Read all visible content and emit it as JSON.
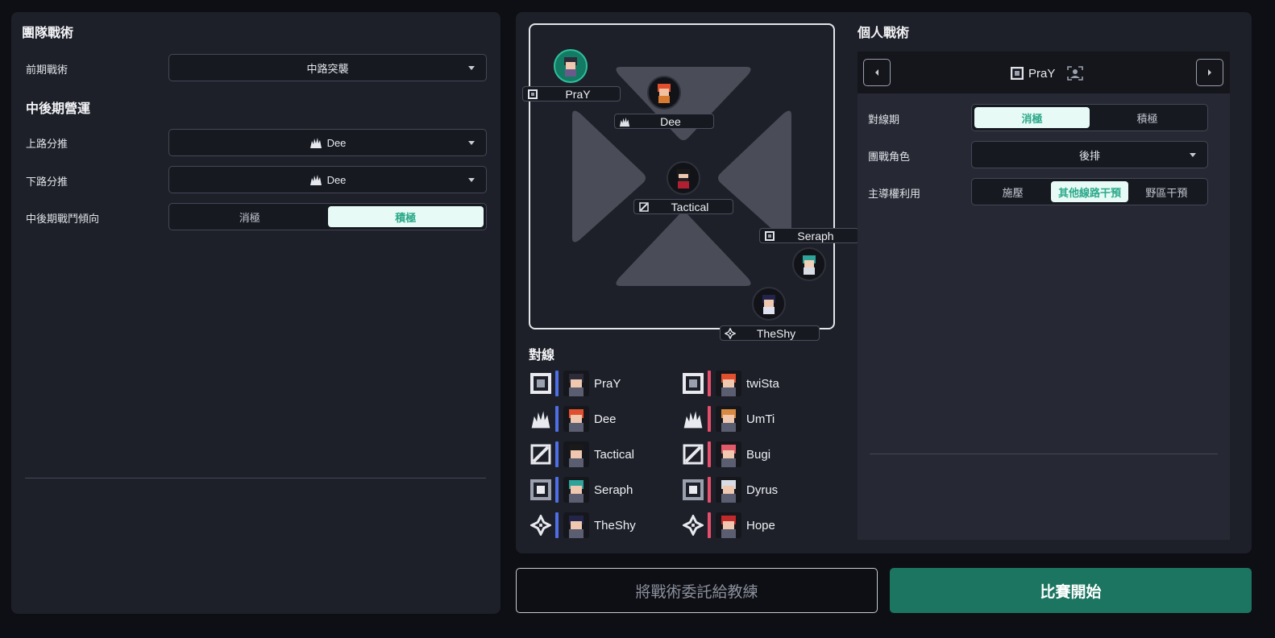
{
  "team_tactics": {
    "title": "團隊戰術",
    "early_label": "前期戰術",
    "early_value": "中路突襲",
    "mid_late_title": "中後期營運",
    "top_push_label": "上路分推",
    "top_push_value": "Dee",
    "bot_push_label": "下路分推",
    "bot_push_value": "Dee",
    "fight_tendency_label": "中後期戰鬥傾向",
    "fight_options": [
      "消極",
      "積極"
    ],
    "fight_selected": "積極"
  },
  "map": {
    "players": [
      {
        "name": "PraY",
        "role_icon": "square-role-icon",
        "selected": true
      },
      {
        "name": "Dee",
        "role_icon": "crown-role-icon"
      },
      {
        "name": "Tactical",
        "role_icon": "slash-role-icon"
      },
      {
        "name": "Seraph",
        "role_icon": "square-role-icon"
      },
      {
        "name": "TheShy",
        "role_icon": "diamond-role-icon"
      }
    ]
  },
  "matchup": {
    "title": "對線",
    "ally": [
      "PraY",
      "Dee",
      "Tactical",
      "Seraph",
      "TheShy"
    ],
    "enemy": [
      "twiSta",
      "UmTi",
      "Bugi",
      "Dyrus",
      "Hope"
    ],
    "colors": {
      "ally": "#4e6fe8",
      "enemy": "#e84e6a"
    }
  },
  "individual": {
    "title": "個人戰術",
    "player": "PraY",
    "laning_label": "對線期",
    "laning_options": [
      "消極",
      "積極"
    ],
    "laning_selected": "消極",
    "teamfight_label": "團戰角色",
    "teamfight_value": "後排",
    "priority_label": "主導權利用",
    "priority_options": [
      "施壓",
      "其他線路干預",
      "野區干預"
    ],
    "priority_selected": "其他線路干預"
  },
  "buttons": {
    "delegate": "將戰術委託給教練",
    "start": "比賽開始"
  },
  "colors": {
    "accent": "#1b7560",
    "active_bg": "#e8faf5",
    "active_text": "#2aa98a"
  }
}
